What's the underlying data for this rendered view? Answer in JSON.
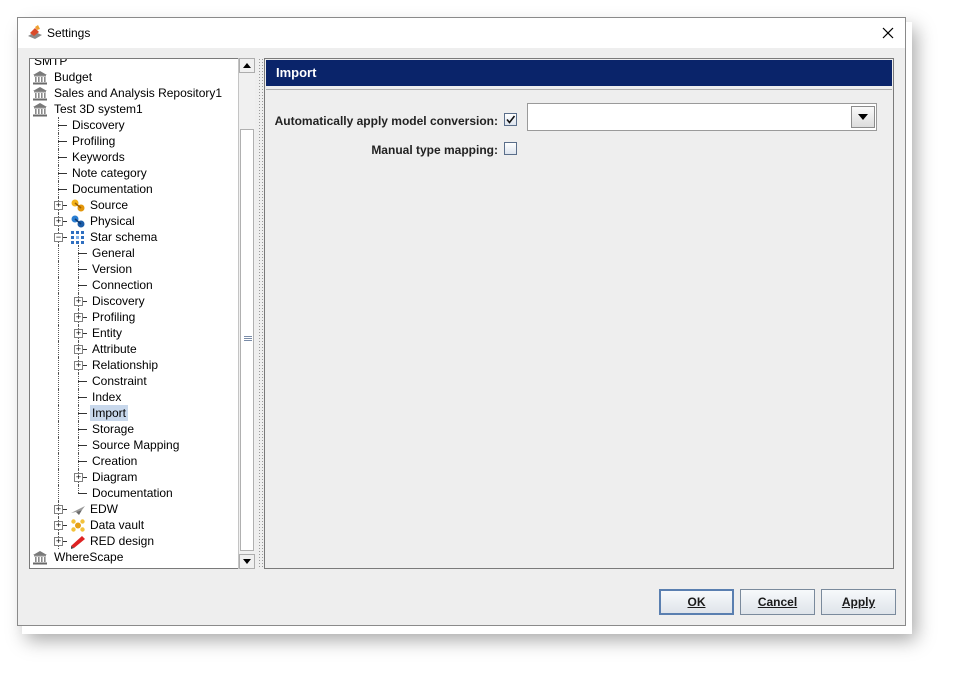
{
  "window": {
    "title": "Settings"
  },
  "tree": {
    "items": [
      {
        "label": "SMTP",
        "depth": 0,
        "icon": "none",
        "expander": "none"
      },
      {
        "label": "Budget",
        "depth": 0,
        "icon": "bank-icon",
        "expander": "none"
      },
      {
        "label": "Sales and Analysis Repository1",
        "depth": 0,
        "icon": "bank-icon",
        "expander": "none"
      },
      {
        "label": "Test 3D system1",
        "depth": 0,
        "icon": "bank-icon",
        "expander": "none"
      },
      {
        "label": "Discovery",
        "depth": 1,
        "icon": "none",
        "expander": "none"
      },
      {
        "label": "Profiling",
        "depth": 1,
        "icon": "none",
        "expander": "none"
      },
      {
        "label": "Keywords",
        "depth": 1,
        "icon": "none",
        "expander": "none"
      },
      {
        "label": "Note category",
        "depth": 1,
        "icon": "none",
        "expander": "none"
      },
      {
        "label": "Documentation",
        "depth": 1,
        "icon": "none",
        "expander": "none"
      },
      {
        "label": "Source",
        "depth": 1,
        "icon": "source-icon",
        "expander": "plus"
      },
      {
        "label": "Physical",
        "depth": 1,
        "icon": "physical-icon",
        "expander": "plus"
      },
      {
        "label": "Star schema",
        "depth": 1,
        "icon": "star-schema-icon",
        "expander": "minus"
      },
      {
        "label": "General",
        "depth": 2,
        "icon": "none",
        "expander": "none"
      },
      {
        "label": "Version",
        "depth": 2,
        "icon": "none",
        "expander": "none"
      },
      {
        "label": "Connection",
        "depth": 2,
        "icon": "none",
        "expander": "none"
      },
      {
        "label": "Discovery",
        "depth": 2,
        "icon": "none",
        "expander": "plus"
      },
      {
        "label": "Profiling",
        "depth": 2,
        "icon": "none",
        "expander": "plus"
      },
      {
        "label": "Entity",
        "depth": 2,
        "icon": "none",
        "expander": "plus"
      },
      {
        "label": "Attribute",
        "depth": 2,
        "icon": "none",
        "expander": "plus"
      },
      {
        "label": "Relationship",
        "depth": 2,
        "icon": "none",
        "expander": "plus"
      },
      {
        "label": "Constraint",
        "depth": 2,
        "icon": "none",
        "expander": "none"
      },
      {
        "label": "Index",
        "depth": 2,
        "icon": "none",
        "expander": "none"
      },
      {
        "label": "Import",
        "depth": 2,
        "icon": "none",
        "expander": "none",
        "selected": true
      },
      {
        "label": "Storage",
        "depth": 2,
        "icon": "none",
        "expander": "none"
      },
      {
        "label": "Source Mapping",
        "depth": 2,
        "icon": "none",
        "expander": "none"
      },
      {
        "label": "Creation",
        "depth": 2,
        "icon": "none",
        "expander": "none"
      },
      {
        "label": "Diagram",
        "depth": 2,
        "icon": "none",
        "expander": "plus"
      },
      {
        "label": "Documentation",
        "depth": 2,
        "icon": "none",
        "expander": "none"
      },
      {
        "label": "EDW",
        "depth": 1,
        "icon": "edw-icon",
        "expander": "plus"
      },
      {
        "label": "Data vault",
        "depth": 1,
        "icon": "data-vault-icon",
        "expander": "plus"
      },
      {
        "label": "RED design",
        "depth": 1,
        "icon": "red-design-icon",
        "expander": "plus"
      },
      {
        "label": "WhereScape",
        "depth": 0,
        "icon": "bank-icon",
        "expander": "none"
      }
    ]
  },
  "panel": {
    "title": "Import",
    "auto_convert_label": "Automatically apply model conversion:",
    "auto_convert_checked": true,
    "conversion_value": "",
    "manual_mapping_label": "Manual type mapping:",
    "manual_mapping_checked": false
  },
  "buttons": {
    "ok": "OK",
    "cancel": "Cancel",
    "apply": "Apply"
  },
  "colors": {
    "header_bg": "#0a246a",
    "selection_bg": "#c8d8ec"
  }
}
